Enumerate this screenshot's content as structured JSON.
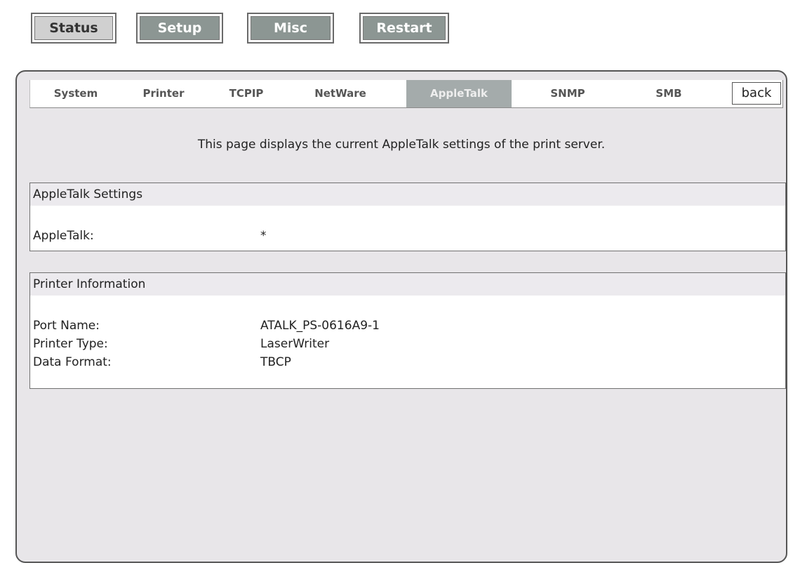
{
  "topnav": {
    "status": "Status",
    "setup": "Setup",
    "misc": "Misc",
    "restart": "Restart"
  },
  "tabs": {
    "system": "System",
    "printer": "Printer",
    "tcpip": "TCPIP",
    "netware": "NetWare",
    "appletalk": "AppleTalk",
    "snmp": "SNMP",
    "smb": "SMB",
    "back": "back"
  },
  "description": "This page displays the current AppleTalk settings of the print server.",
  "appletalk_settings": {
    "title": "AppleTalk Settings",
    "appletalk_label": "AppleTalk:",
    "appletalk_value": "*"
  },
  "printer_info": {
    "title": "Printer Information",
    "port_name_label": "Port Name:",
    "port_name_value": "ATALK_PS-0616A9-1",
    "printer_type_label": "Printer Type:",
    "printer_type_value": "LaserWriter",
    "data_format_label": "Data Format:",
    "data_format_value": "TBCP"
  },
  "colors": {
    "panel_bg": "#e8e6e9",
    "active_tab_bg": "#a4abab",
    "dark_button_bg": "#8c9693",
    "light_button_bg": "#d0d0d0"
  }
}
